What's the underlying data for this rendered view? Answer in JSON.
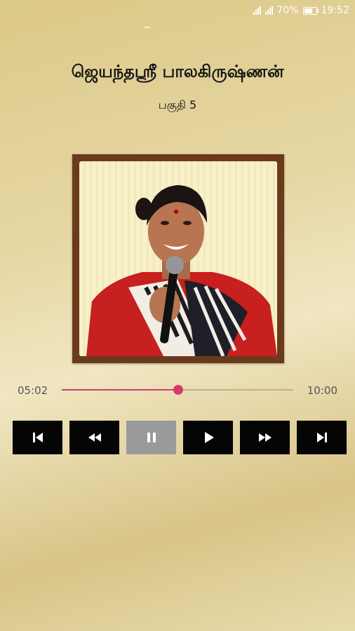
{
  "status_bar": {
    "battery": "70%",
    "time": "19:52"
  },
  "track": {
    "title": "ஜெயந்தஸ்ரீ பாலகிருஷ்ணன்",
    "subtitle": "பகுதி 5"
  },
  "player": {
    "elapsed": "05:02",
    "total": "10:00",
    "progress_fraction": 0.503,
    "accent_color": "#d33a6e"
  },
  "controls": [
    {
      "name": "skip-previous-button",
      "icon": "skip-previous-icon"
    },
    {
      "name": "rewind-button",
      "icon": "rewind-icon"
    },
    {
      "name": "pause-button",
      "icon": "pause-icon",
      "disabled": true
    },
    {
      "name": "play-button",
      "icon": "play-icon"
    },
    {
      "name": "fast-forward-button",
      "icon": "fast-forward-icon"
    },
    {
      "name": "skip-next-button",
      "icon": "skip-next-icon"
    }
  ]
}
